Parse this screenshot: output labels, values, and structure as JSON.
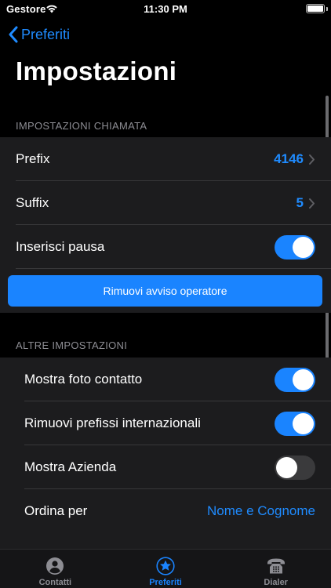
{
  "status_bar": {
    "carrier": "Gestore",
    "time": "11:30 PM",
    "battery_level": 1.0
  },
  "nav": {
    "back_label": "Preferiti",
    "title": "Impostazioni"
  },
  "call_settings": {
    "header": "IMPOSTAZIONI CHIAMATA",
    "prefix_label": "Prefix",
    "prefix_value": "4146",
    "suffix_label": "Suffix",
    "suffix_value": "5",
    "pause_label": "Inserisci pausa",
    "pause_on": true,
    "remove_notice_button": "Rimuovi avviso operatore"
  },
  "other_settings": {
    "header": "ALTRE IMPOSTAZIONI",
    "photo_label": "Mostra foto contatto",
    "photo_on": true,
    "intl_label": "Rimuovi prefissi internazionali",
    "intl_on": true,
    "company_label": "Mostra Azienda",
    "company_on": false,
    "sort_label": "Ordina per",
    "sort_value": "Nome e Cognome"
  },
  "tab_bar": {
    "selected": "Preferiti",
    "tabs": [
      {
        "label": "Contatti",
        "icon": "person-circle-icon"
      },
      {
        "label": "Preferiti",
        "icon": "star-circle-icon"
      },
      {
        "label": "Dialer",
        "icon": "telephone-icon"
      }
    ]
  },
  "colors": {
    "accent": "#1a84ff",
    "background": "#000000",
    "cell": "#1c1c1e",
    "secondary_text": "#8d8d93"
  }
}
